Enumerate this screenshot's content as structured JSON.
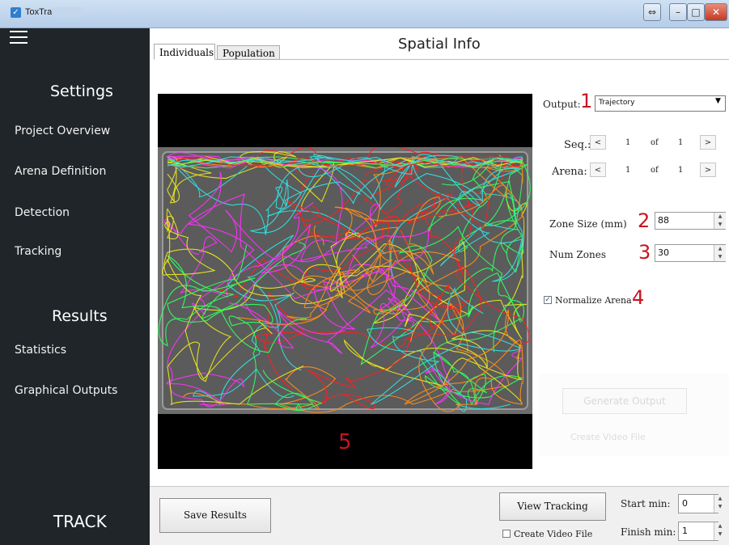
{
  "window": {
    "title": "ToxTrack"
  },
  "sidebar": {
    "settings_heading": "Settings",
    "settings_items": [
      "Project Overview",
      "Arena Definition",
      "Detection",
      "Tracking"
    ],
    "results_heading": "Results",
    "results_items": [
      "Statistics",
      "Graphical Outputs"
    ],
    "brand": "TRACK"
  },
  "main": {
    "title": "Spatial Info",
    "tabs": [
      {
        "label": "Individuals",
        "active": true
      },
      {
        "label": "Population",
        "active": false
      }
    ],
    "image_marker": "5"
  },
  "controls": {
    "output": {
      "marker": "1",
      "label": "Output:",
      "value": "Trajectory"
    },
    "seq": {
      "label": "Seq.:",
      "current": "1",
      "of": "of",
      "total": "1",
      "prev": "<",
      "next": ">"
    },
    "arena": {
      "label": "Arena:",
      "current": "1",
      "of": "of",
      "total": "1",
      "prev": "<",
      "next": ">"
    },
    "zone_size": {
      "label": "Zone Size (mm)",
      "marker": "2",
      "value": "88"
    },
    "num_zones": {
      "label": "Num Zones",
      "marker": "3",
      "value": "30"
    },
    "normalize": {
      "label": "Normalize Arena",
      "marker": "4",
      "checked": true
    },
    "generate_output_label": "Generate Output",
    "faded_video_label": "Create Video File"
  },
  "bottom": {
    "save_label": "Save Results",
    "view_tracking_label": "View Tracking",
    "create_video_label": "Create Video File",
    "create_video_checked": false,
    "start_label": "Start min:",
    "start_value": "0",
    "finish_label": "Finish min:",
    "finish_value": "1"
  },
  "colors": {
    "sidebar_bg": "#1f2528",
    "marker_red": "#c8141e",
    "trajectory_colors": [
      "#e8e820",
      "#ff2020",
      "#30ff60",
      "#30e0e0",
      "#ff30ff",
      "#ff8c1a"
    ]
  }
}
